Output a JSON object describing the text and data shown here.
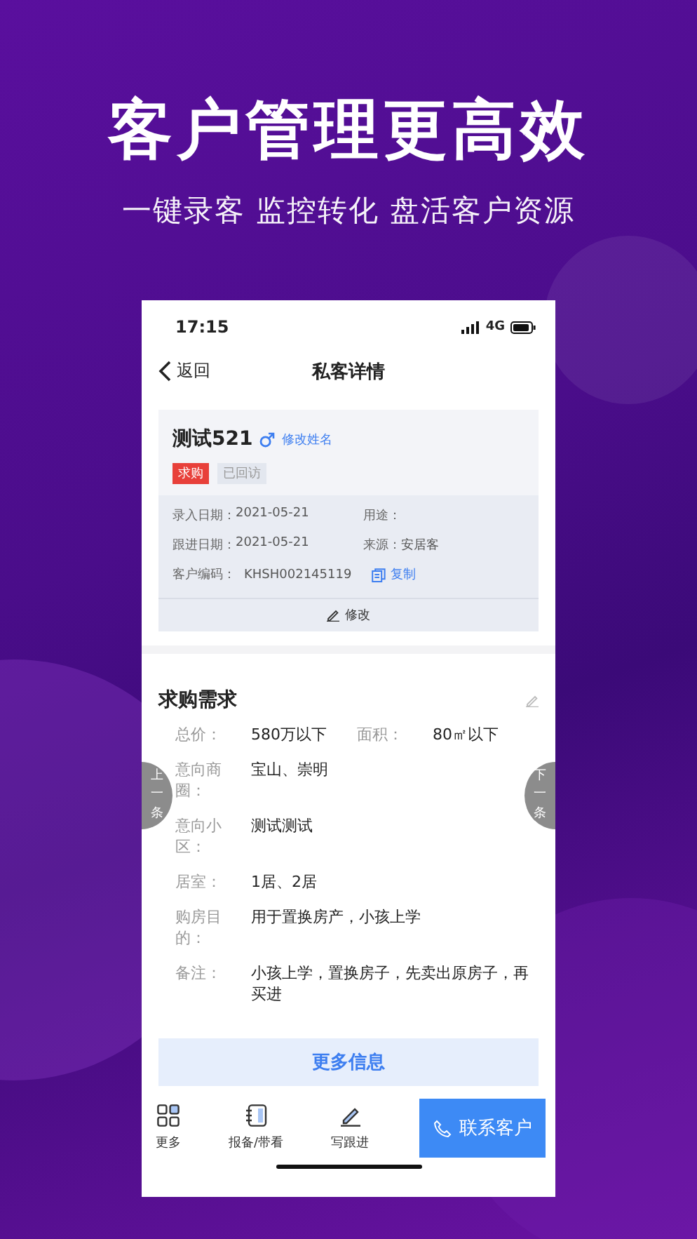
{
  "headline": "客户管理更高效",
  "subheadline": "一键录客 监控转化 盘活客户资源",
  "status_bar": {
    "time": "17:15",
    "network": "4G"
  },
  "nav": {
    "back": "返回",
    "title": "私客详情"
  },
  "customer": {
    "name": "测试521",
    "rename": "修改姓名",
    "tags": [
      {
        "label": "求购",
        "kind": "primary"
      },
      {
        "label": "已回访",
        "kind": "muted"
      }
    ],
    "info": [
      {
        "label": "录入日期：",
        "value": "2021-05-21"
      },
      {
        "label": "用途："
      },
      {
        "label": "跟进日期：",
        "value": "2021-05-21"
      },
      {
        "label": "来源：",
        "value": "安居客"
      }
    ],
    "code_label": "客户编码：",
    "code": "KHSH002145119",
    "copy": "复制",
    "edit": "修改"
  },
  "demand": {
    "title": "求购需求",
    "pair": [
      {
        "label": "总价：",
        "value": "580万以下"
      },
      {
        "label": "面积：",
        "value": "80㎡以下"
      }
    ],
    "rows": [
      {
        "label": "意向商圈：",
        "value": "宝山、崇明"
      },
      {
        "label": "意向小区：",
        "value": "测试测试"
      },
      {
        "label": "居室：",
        "value": "1居、2居"
      },
      {
        "label": "购房目的：",
        "value": "用于置换房产，小孩上学"
      },
      {
        "label": "备注：",
        "value": "小孩上学，置换房子，先卖出原房子，再买进"
      }
    ]
  },
  "prev": "上一条",
  "next": "下一条",
  "more_info": "更多信息",
  "bottom_bar": {
    "actions": [
      {
        "label": "更多",
        "kind": "grid"
      },
      {
        "label": "报备/带看",
        "kind": "notebook"
      },
      {
        "label": "写跟进",
        "kind": "pen"
      }
    ],
    "contact": "联系客户"
  }
}
